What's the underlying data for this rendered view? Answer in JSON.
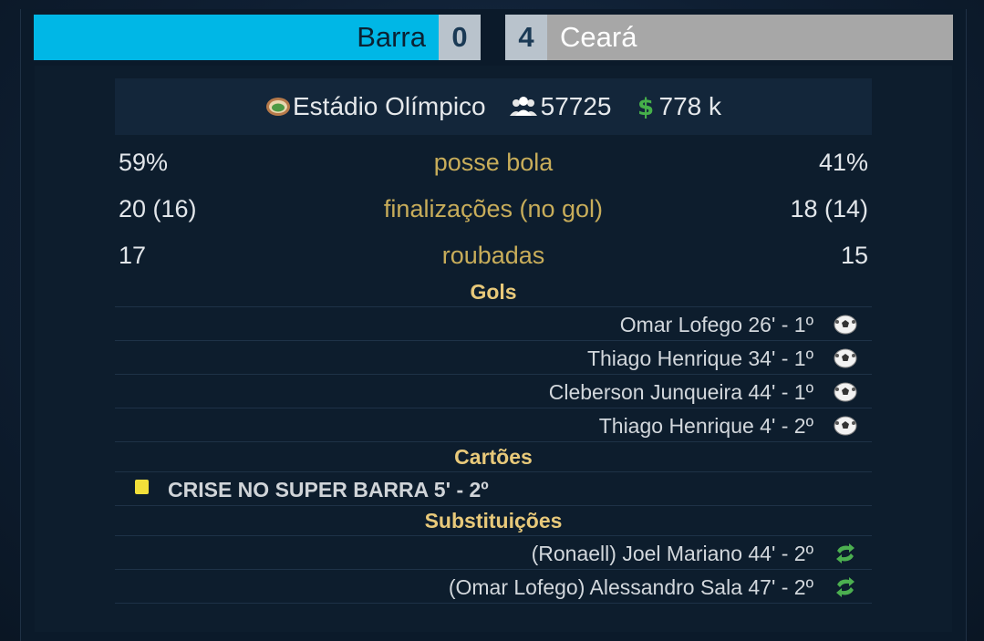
{
  "match": {
    "home": {
      "name": "Barra",
      "score": "0",
      "color": "#00b7e6"
    },
    "away": {
      "name": "Ceará",
      "score": "4",
      "color": "#a7a7a7"
    }
  },
  "venue": {
    "stadium": "Estádio Olímpico",
    "attendance": "57725",
    "income": "778 k",
    "icons": [
      "stadium-icon",
      "people-icon",
      "money-icon"
    ]
  },
  "stats": [
    {
      "label": "posse bola",
      "home": "59%",
      "away": "41%"
    },
    {
      "label": "finalizações (no gol)",
      "home": "20 (16)",
      "away": "18 (14)"
    },
    {
      "label": "roubadas",
      "home": "17",
      "away": "15"
    }
  ],
  "sections": {
    "goals_title": "Gols",
    "cards_title": "Cartões",
    "subs_title": "Substituições"
  },
  "goals": [
    {
      "text": "Omar Lofego 26' - 1º",
      "icon": "ball-icon"
    },
    {
      "text": "Thiago Henrique 34' - 1º",
      "icon": "ball-icon"
    },
    {
      "text": "Cleberson Junqueira 44' - 1º",
      "icon": "ball-icon"
    },
    {
      "text": "Thiago Henrique 4' - 2º",
      "icon": "ball-icon"
    }
  ],
  "cards": [
    {
      "text": "CRISE NO SUPER BARRA 5' - 2º",
      "type": "yellow",
      "color": "#f2df3a"
    }
  ],
  "subs": [
    {
      "text": "(Ronaell) Joel Mariano 44' - 2º",
      "icon": "substitution-icon"
    },
    {
      "text": "(Omar Lofego) Alessandro Sala 47' - 2º",
      "icon": "substitution-icon"
    }
  ]
}
